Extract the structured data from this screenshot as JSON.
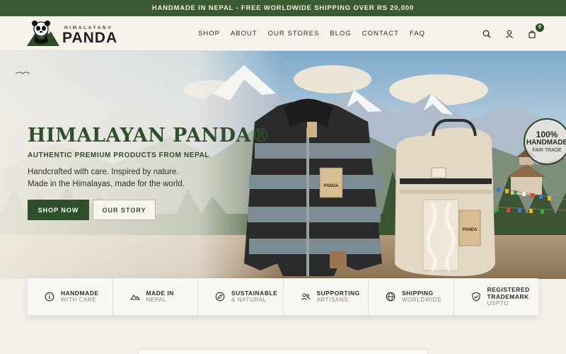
{
  "announcement": "HANDMADE IN NEPAL - FREE WORLDWIDE SHIPPING OVER RS 20,000",
  "logo": {
    "small": "HIMALAYAN®",
    "big": "PANDA",
    "icon": "panda-mountain-logo"
  },
  "nav": {
    "items": [
      {
        "label": "SHOP"
      },
      {
        "label": "ABOUT"
      },
      {
        "label": "OUR STORES"
      },
      {
        "label": "BLOG"
      },
      {
        "label": "CONTACT"
      },
      {
        "label": "FAQ"
      }
    ]
  },
  "header_icons": {
    "search": "search-icon",
    "account": "user-icon",
    "cart": "bag-icon",
    "cart_count": "0"
  },
  "hero": {
    "title": "HIMALAYAN PANDA®",
    "subtitle": "AUTHENTIC PREMIUM PRODUCTS FROM NEPAL",
    "line1": "Handcrafted with care. Inspired by nature.",
    "line2": "Made in the Himalayas, made for the world.",
    "primary_cta": "SHOP NOW",
    "secondary_cta": "OUR STORY",
    "badge": {
      "line1": "100%",
      "line2": "HANDMADE",
      "line3": "FAIR TRADE"
    },
    "jacket_tag": "PANDA",
    "bag_tag": "PANDA"
  },
  "features": [
    {
      "title": "HANDMADE",
      "subtitle": "WITH CARE",
      "icon": "info-circle-icon"
    },
    {
      "title": "MADE IN",
      "subtitle": "NEPAL",
      "icon": "mountain-icon"
    },
    {
      "title": "SUSTAINABLE",
      "subtitle": "& NATURAL",
      "icon": "compass-leaf-icon"
    },
    {
      "title": "SUPPORTING",
      "subtitle": "ARTISANS",
      "icon": "people-icon"
    },
    {
      "title": "SHIPPING",
      "subtitle": "WORLDWIDE",
      "icon": "globe-icon"
    },
    {
      "title": "REGISTERED TRADEMARK",
      "subtitle": "USPTO",
      "icon": "shield-check-icon"
    }
  ],
  "colors": {
    "brand_green": "#2f4e2b",
    "announcement_bg": "#3a5a32",
    "page_bg": "#f4efe9"
  }
}
